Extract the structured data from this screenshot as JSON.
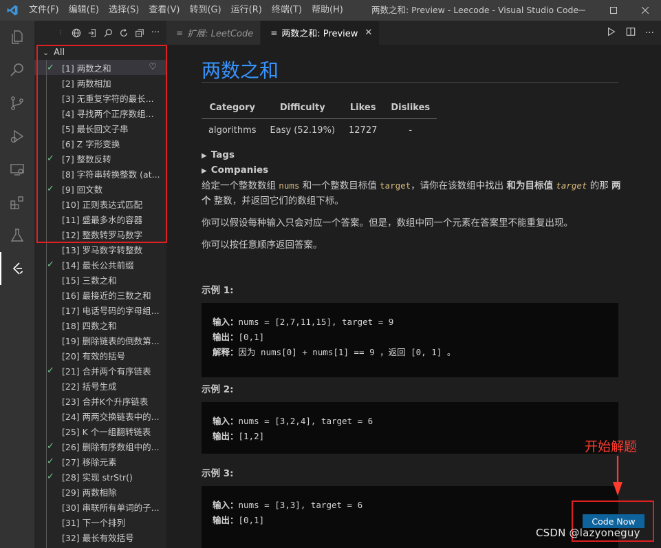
{
  "window": {
    "title": "两数之和: Preview - Leecode - Visual Studio Code",
    "menus": [
      "文件(F)",
      "编辑(E)",
      "选择(S)",
      "查看(V)",
      "转到(G)",
      "运行(R)",
      "终端(T)",
      "帮助(H)"
    ],
    "controls": [
      "minimize-icon",
      "maximize-icon",
      "close-icon"
    ]
  },
  "activity_bar": [
    "explorer-icon",
    "search-icon",
    "source-control-icon",
    "run-debug-icon",
    "remote-explorer-icon",
    "extensions-icon",
    "testing-icon",
    "leetcode-icon"
  ],
  "sidebar": {
    "toolbar": [
      "globe-icon",
      "sign-in-icon",
      "search-icon",
      "refresh-icon",
      "collapse-icon",
      "more-icon"
    ],
    "root_label": "All",
    "items": [
      {
        "label": "[1] 两数之和",
        "solved": true,
        "favorite": true
      },
      {
        "label": "[2] 两数相加",
        "solved": false
      },
      {
        "label": "[3] 无重复字符的最长...",
        "solved": false
      },
      {
        "label": "[4] 寻找两个正序数组...",
        "solved": false
      },
      {
        "label": "[5] 最长回文子串",
        "solved": false
      },
      {
        "label": "[6] Z 字形变换",
        "solved": false
      },
      {
        "label": "[7] 整数反转",
        "solved": true
      },
      {
        "label": "[8] 字符串转换整数 (at...",
        "solved": false
      },
      {
        "label": "[9] 回文数",
        "solved": true
      },
      {
        "label": "[10] 正则表达式匹配",
        "solved": false
      },
      {
        "label": "[11] 盛最多水的容器",
        "solved": false
      },
      {
        "label": "[12] 整数转罗马数字",
        "solved": false
      },
      {
        "label": "[13] 罗马数字转整数",
        "solved": false
      },
      {
        "label": "[14] 最长公共前缀",
        "solved": true
      },
      {
        "label": "[15] 三数之和",
        "solved": false
      },
      {
        "label": "[16] 最接近的三数之和",
        "solved": false
      },
      {
        "label": "[17] 电话号码的字母组...",
        "solved": false
      },
      {
        "label": "[18] 四数之和",
        "solved": false
      },
      {
        "label": "[19] 删除链表的倒数第...",
        "solved": false
      },
      {
        "label": "[20] 有效的括号",
        "solved": false
      },
      {
        "label": "[21] 合并两个有序链表",
        "solved": true
      },
      {
        "label": "[22] 括号生成",
        "solved": false
      },
      {
        "label": "[23] 合并K个升序链表",
        "solved": false
      },
      {
        "label": "[24] 两两交换链表中的...",
        "solved": false
      },
      {
        "label": "[25] K 个一组翻转链表",
        "solved": false
      },
      {
        "label": "[26] 删除有序数组中的...",
        "solved": true
      },
      {
        "label": "[27] 移除元素",
        "solved": true
      },
      {
        "label": "[28] 实现 strStr()",
        "solved": true
      },
      {
        "label": "[29] 两数相除",
        "solved": false
      },
      {
        "label": "[30] 串联所有单词的子...",
        "solved": false
      },
      {
        "label": "[31] 下一个排列",
        "solved": false
      },
      {
        "label": "[32] 最长有效括号",
        "solved": false
      }
    ]
  },
  "tabs": [
    {
      "label": "扩展: LeetCode",
      "active": false
    },
    {
      "label": "两数之和: Preview",
      "active": true
    }
  ],
  "editor_actions": [
    "run-icon",
    "split-editor-icon",
    "more-icon"
  ],
  "preview": {
    "title": "两数之和",
    "table": {
      "headers": [
        "Category",
        "Difficulty",
        "Likes",
        "Dislikes"
      ],
      "row": [
        "algorithms",
        "Easy (52.19%)",
        "12727",
        "-"
      ]
    },
    "tags_label": "Tags",
    "companies_label": "Companies",
    "desc1": {
      "a": "给定一个整数数组 ",
      "b": "nums",
      "c": " 和一个整数目标值 ",
      "d": "target",
      "e": "，请你在该数组中找出 ",
      "f": "和为目标值",
      "g": " ",
      "h": "target",
      "i": " 的那 ",
      "j": "两个",
      "k": " 整数，并返回它们的数组下标。"
    },
    "desc2": "你可以假设每种输入只会对应一个答案。但是，数组中同一个元素在答案里不能重复出现。",
    "desc3": "你可以按任意顺序返回答案。",
    "examples": [
      {
        "title": "示例 1:",
        "input_label": "输入：",
        "input": "nums = [2,7,11,15], target = 9",
        "output_label": "输出：",
        "output": "[0,1]",
        "explain_label": "解释：",
        "explain": "因为 nums[0] + nums[1] == 9 ，返回 [0, 1] 。"
      },
      {
        "title": "示例 2:",
        "input_label": "输入：",
        "input": "nums = [3,2,4], target = 6",
        "output_label": "输出：",
        "output": "[1,2]"
      },
      {
        "title": "示例 3:",
        "input_label": "输入：",
        "input": "nums = [3,3], target = 6",
        "output_label": "输出：",
        "output": "[0,1]"
      }
    ],
    "button": "Code Now"
  },
  "annotation": {
    "text": "开始解题",
    "color": "#ff3b2f"
  },
  "watermark": "CSDN @lazyoneguy",
  "colors": {
    "accent": "#3794ff",
    "button": "#0e639c",
    "check": "#73c991",
    "annotation": "#e02020"
  }
}
